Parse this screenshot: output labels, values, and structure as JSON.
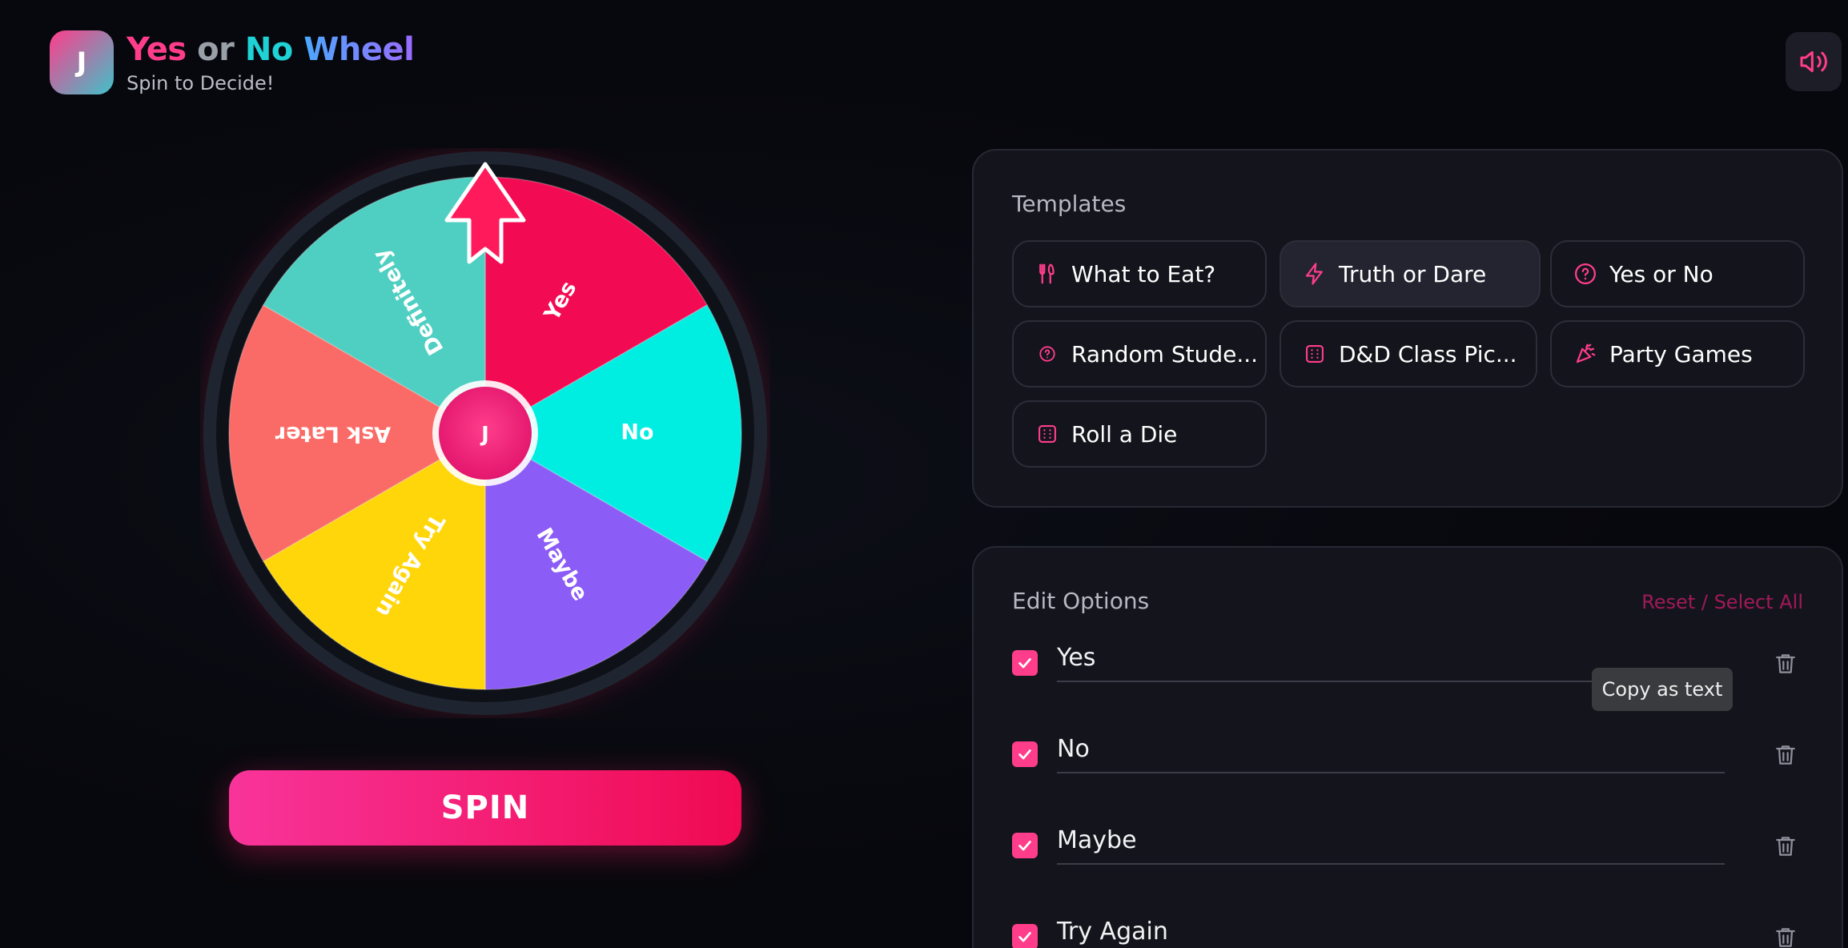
{
  "header": {
    "logo_letter": "J",
    "title_yes": "Yes",
    "title_or": "or",
    "title_no": "No",
    "title_wheel": "Wheel",
    "subtitle": "Spin to Decide!"
  },
  "sound_button": {
    "icon": "speaker-volume-icon"
  },
  "wheel": {
    "center_label": "J",
    "segments": [
      {
        "label": "Yes",
        "color": "#f20b53"
      },
      {
        "label": "No",
        "color": "#00eee2"
      },
      {
        "label": "Maybe",
        "color": "#8b5cf6"
      },
      {
        "label": "Try Again",
        "color": "#ffd60a"
      },
      {
        "label": "Ask Later",
        "color": "#fa6b67"
      },
      {
        "label": "Definitely",
        "color": "#4fcfc2"
      }
    ],
    "pointer_color": "#ff1a5c",
    "glow_color": "#ff1a5c"
  },
  "spin_button": {
    "label": "SPIN"
  },
  "templates": {
    "heading": "Templates",
    "items": [
      {
        "label": "What to Eat?",
        "icon": "utensils-icon"
      },
      {
        "label": "Truth or Dare",
        "icon": "lightning-icon"
      },
      {
        "label": "Yes or No",
        "icon": "question-circle-icon"
      },
      {
        "label": "Random Stude...",
        "icon": "question-circle-small-icon"
      },
      {
        "label": "D&D Class Pic...",
        "icon": "dice-icon"
      },
      {
        "label": "Party Games",
        "icon": "party-popper-icon"
      },
      {
        "label": "Roll a Die",
        "icon": "dice-icon"
      }
    ]
  },
  "options": {
    "heading": "Edit Options",
    "reset_label": "Reset / Select All",
    "items": [
      {
        "label": "Yes",
        "checked": true
      },
      {
        "label": "No",
        "checked": true
      },
      {
        "label": "Maybe",
        "checked": true
      },
      {
        "label": "Try Again",
        "checked": true
      }
    ]
  },
  "tooltip": {
    "text": "Copy as text"
  },
  "colors": {
    "accent": "#ff3d8b",
    "panel_bg": "#14151c"
  }
}
